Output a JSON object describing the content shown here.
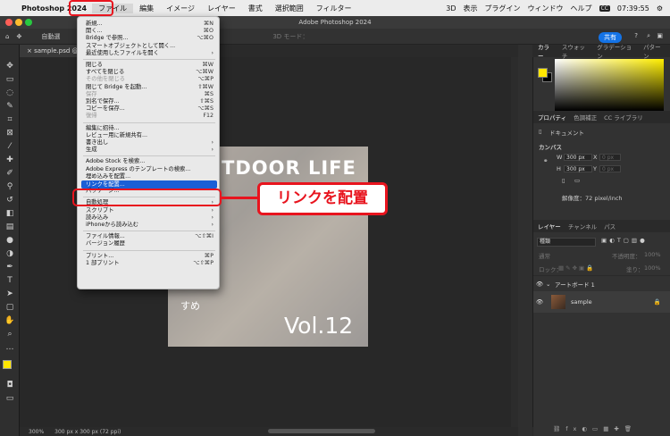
{
  "menubar": {
    "app": "Photoshop 2024",
    "items": [
      "ファイル",
      "編集",
      "イメージ",
      "レイヤー",
      "書式",
      "選択範囲",
      "フィルター",
      "3D",
      "表示",
      "プラグイン",
      "ウィンドウ",
      "ヘルプ"
    ],
    "clock": "07:39:55",
    "cc_chip": "CC"
  },
  "window": {
    "title": "Adobe Photoshop 2024"
  },
  "options": {
    "autoselect": "自動選",
    "mode3d": "3D モード：",
    "share": "共有"
  },
  "document_tab": "sample.psd @ 3",
  "file_menu": [
    {
      "label": "新規...",
      "shortcut": "⌘N"
    },
    {
      "label": "開く...",
      "shortcut": "⌘O"
    },
    {
      "label": "Bridge で参照...",
      "shortcut": "⌥⌘O"
    },
    {
      "label": "スマートオブジェクトとして開く...",
      "shortcut": ""
    },
    {
      "label": "最近使用したファイルを開く",
      "shortcut": "›"
    },
    {
      "sep": true
    },
    {
      "label": "閉じる",
      "shortcut": "⌘W"
    },
    {
      "label": "すべてを閉じる",
      "shortcut": "⌥⌘W"
    },
    {
      "label": "その他を閉じる",
      "shortcut": "⌥⌘P",
      "disabled": true
    },
    {
      "label": "閉じて Bridge を起動...",
      "shortcut": "⇧⌘W"
    },
    {
      "label": "保存",
      "shortcut": "⌘S",
      "disabled": true
    },
    {
      "label": "別名で保存...",
      "shortcut": "⇧⌘S"
    },
    {
      "label": "コピーを保存...",
      "shortcut": "⌥⌘S"
    },
    {
      "label": "復帰",
      "shortcut": "F12",
      "disabled": true
    },
    {
      "sep": true
    },
    {
      "label": "編集に招待...",
      "shortcut": ""
    },
    {
      "label": "レビュー用に新規共有...",
      "shortcut": ""
    },
    {
      "label": "書き出し",
      "shortcut": "›"
    },
    {
      "label": "生成",
      "shortcut": "›"
    },
    {
      "sep": true
    },
    {
      "label": "Adobe Stock を検索...",
      "shortcut": ""
    },
    {
      "label": "Adobe Express のテンプレートの検索...",
      "shortcut": ""
    },
    {
      "label": "埋め込みを配置...",
      "shortcut": ""
    },
    {
      "label": "リンクを配置...",
      "shortcut": "",
      "highlight": true
    },
    {
      "label": "パッケージ...",
      "shortcut": ""
    },
    {
      "sep": true
    },
    {
      "label": "自動処理",
      "shortcut": "›"
    },
    {
      "label": "スクリプト",
      "shortcut": "›"
    },
    {
      "label": "読み込み",
      "shortcut": "›"
    },
    {
      "label": "iPhoneから読み込む",
      "shortcut": "›"
    },
    {
      "sep": true
    },
    {
      "label": "ファイル情報...",
      "shortcut": "⌥⇧⌘I"
    },
    {
      "label": "バージョン履歴",
      "shortcut": ""
    },
    {
      "sep": true
    },
    {
      "label": "プリント...",
      "shortcut": "⌘P"
    },
    {
      "label": "1 部プリント",
      "shortcut": "⌥⇧⌘P"
    }
  ],
  "callout": "リンクを配置",
  "artboard": {
    "title": "TDOOR LIFE",
    "vol": "Vol.12",
    "side": "すめ"
  },
  "status": {
    "zoom": "300%",
    "size": "300 px x 300 px (72 ppi)"
  },
  "color_panel": {
    "tabs": [
      "カラー",
      "スウォッチ",
      "グラデーション",
      "パターン"
    ]
  },
  "properties_panel": {
    "tabs": [
      "プロパティ",
      "色調補正",
      "CC ライブラリ"
    ],
    "doc": "ドキュメント",
    "canvas": "カンバス",
    "w_label": "W",
    "w": "300 px",
    "h_label": "H",
    "h": "300 px",
    "x_label": "X",
    "x": "0 px",
    "y_label": "Y",
    "y": "0 px",
    "resolution": "解像度：72 pixel/inch"
  },
  "layers_panel": {
    "tabs": [
      "レイヤー",
      "チャンネル",
      "パス"
    ],
    "filter": "種類",
    "blend": "通常",
    "opacity_label": "不透明度：",
    "opacity": "100%",
    "lock_label": "ロック：",
    "fill_label": "塗り：",
    "fill": "100%",
    "layers": [
      {
        "name": "アートボード 1",
        "type": "artboard"
      },
      {
        "name": "sample",
        "type": "layer"
      }
    ]
  },
  "colors": {
    "accent": "#e8141e",
    "highlight": "#1a5fd6",
    "share": "#1473e6"
  }
}
